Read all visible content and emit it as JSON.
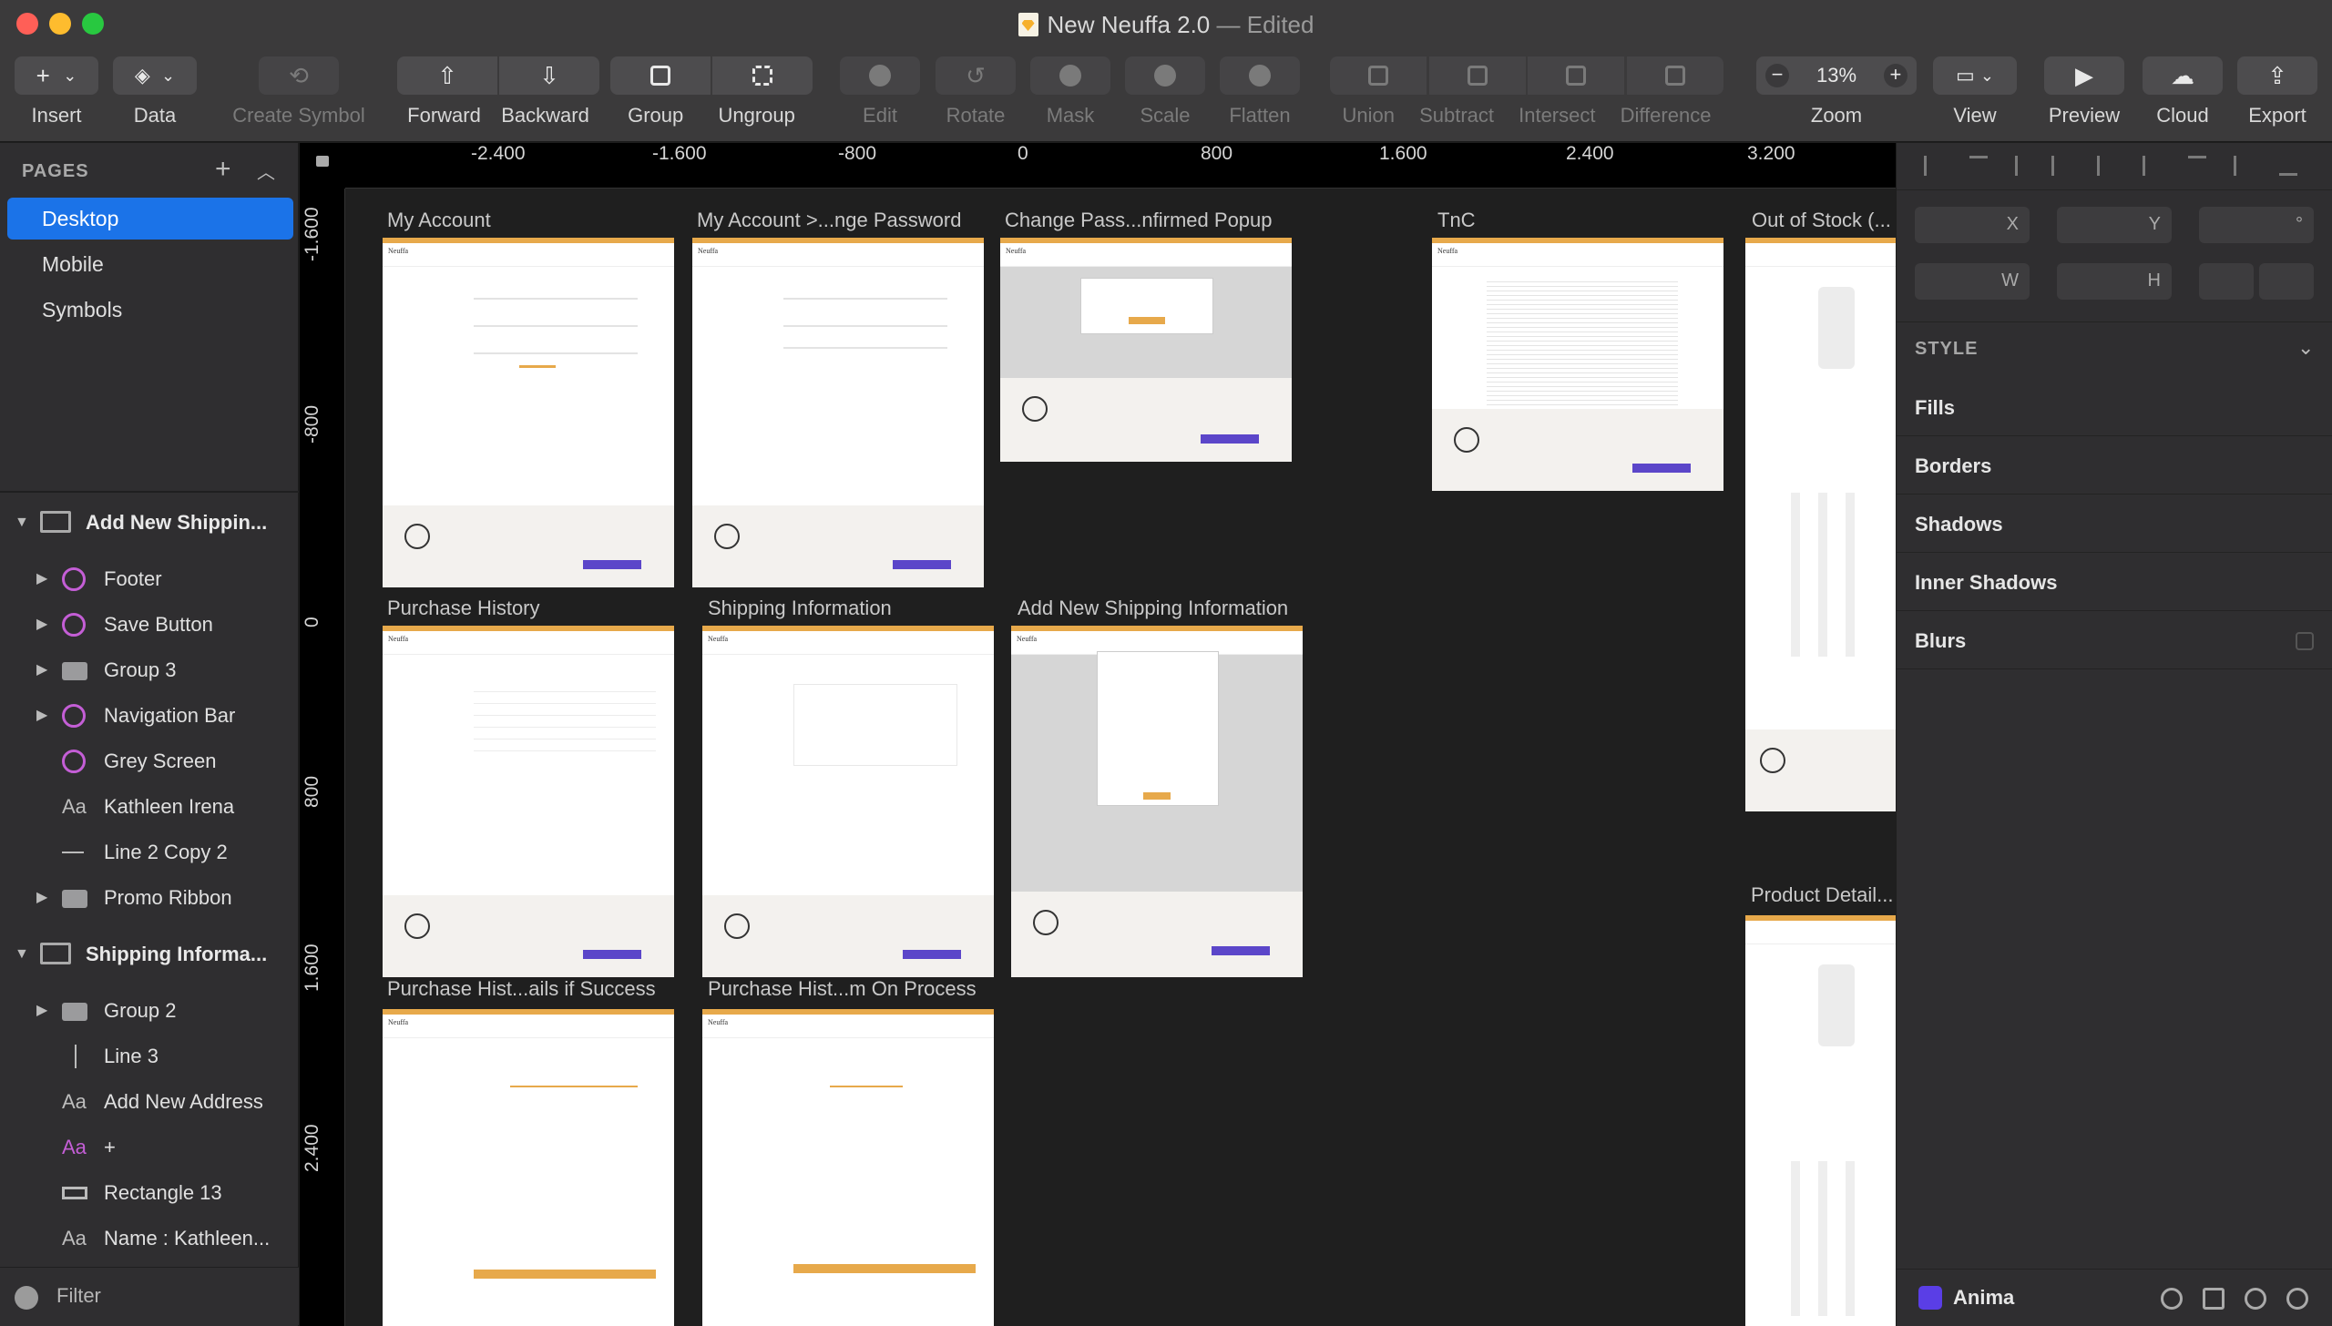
{
  "window": {
    "title": "New Neuffa 2.0",
    "status": "— Edited"
  },
  "toolbar": {
    "insert": "Insert",
    "data": "Data",
    "create_symbol": "Create Symbol",
    "forward": "Forward",
    "backward": "Backward",
    "group": "Group",
    "ungroup": "Ungroup",
    "edit": "Edit",
    "rotate": "Rotate",
    "mask": "Mask",
    "scale": "Scale",
    "flatten": "Flatten",
    "union": "Union",
    "subtract": "Subtract",
    "intersect": "Intersect",
    "difference": "Difference",
    "zoom_label": "Zoom",
    "zoom_value": "13%",
    "zoom_minus": "−",
    "zoom_plus": "+",
    "view": "View",
    "preview": "Preview",
    "cloud": "Cloud",
    "export": "Export"
  },
  "pages": {
    "header": "PAGES",
    "items": [
      {
        "label": "Desktop",
        "selected": true
      },
      {
        "label": "Mobile"
      },
      {
        "label": "Symbols"
      }
    ]
  },
  "layers": [
    {
      "label": "Add New Shippin...",
      "kind": "artboard",
      "expanded": true
    },
    {
      "label": "Footer",
      "kind": "symbol",
      "has_children": true
    },
    {
      "label": "Save Button",
      "kind": "symbol",
      "has_children": true
    },
    {
      "label": "Group 3",
      "kind": "group",
      "has_children": true
    },
    {
      "label": "Navigation Bar",
      "kind": "symbol",
      "has_children": true
    },
    {
      "label": "Grey Screen",
      "kind": "symbol"
    },
    {
      "label": "Kathleen Irena",
      "kind": "text"
    },
    {
      "label": "Line 2 Copy 2",
      "kind": "line"
    },
    {
      "label": "Promo Ribbon",
      "kind": "group",
      "has_children": true
    },
    {
      "label": "Shipping Informa...",
      "kind": "artboard",
      "expanded": true
    },
    {
      "label": "Group 2",
      "kind": "group",
      "has_children": true
    },
    {
      "label": "Line 3",
      "kind": "vline"
    },
    {
      "label": "Add New Address",
      "kind": "text"
    },
    {
      "label": "+",
      "kind": "text-pink"
    },
    {
      "label": "Rectangle 13",
      "kind": "rect"
    },
    {
      "label": "Name : Kathleen...",
      "kind": "text"
    }
  ],
  "filter": {
    "label": "Filter"
  },
  "rulers": {
    "horizontal": [
      "-2.400",
      "-1.600",
      "-800",
      "0",
      "800",
      "1.600",
      "2.400",
      "3.200"
    ],
    "vertical": [
      "-1.600",
      "-800",
      "0",
      "800",
      "1.600",
      "2.400"
    ]
  },
  "artboards": [
    {
      "title": "My Account"
    },
    {
      "title": "My Account >...nge Password"
    },
    {
      "title": "Change Pass...nfirmed Popup"
    },
    {
      "title": "TnC"
    },
    {
      "title": "Out of Stock (..."
    },
    {
      "title": "Purchase History"
    },
    {
      "title": "Shipping Information"
    },
    {
      "title": "Add New Shipping Information"
    },
    {
      "title": "Product Detail..."
    },
    {
      "title": "Purchase Hist...ails if Success"
    },
    {
      "title": "Purchase Hist...m On Process"
    }
  ],
  "artboard_logo": "Neuffa",
  "inspector": {
    "x": "X",
    "y": "Y",
    "rotation": "°",
    "w": "W",
    "h": "H",
    "style": "STYLE",
    "fills": "Fills",
    "borders": "Borders",
    "shadows": "Shadows",
    "inner_shadows": "Inner Shadows",
    "blurs": "Blurs",
    "plugin": "Anima"
  }
}
